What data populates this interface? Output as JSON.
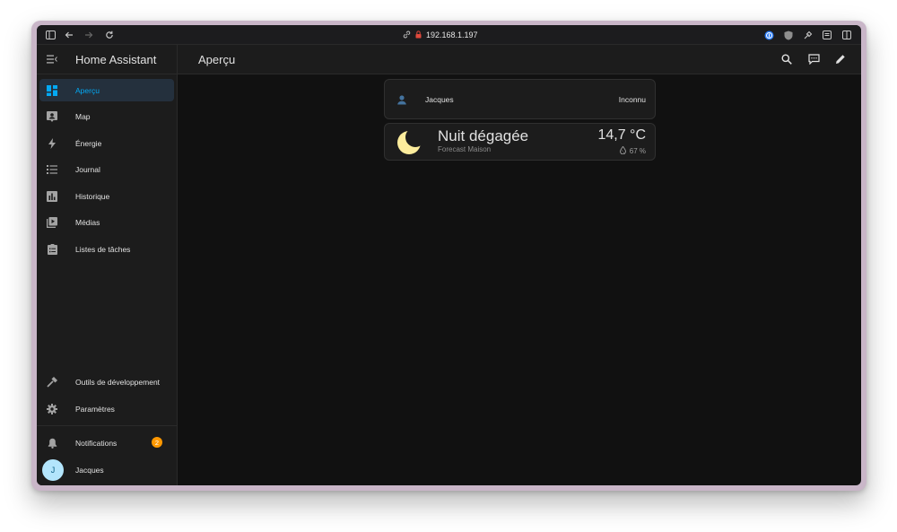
{
  "browser": {
    "url": "192.168.1.197"
  },
  "app": {
    "title": "Home Assistant",
    "page_title": "Aperçu"
  },
  "sidebar": {
    "items": [
      {
        "label": "Aperçu",
        "icon": "dashboard-icon",
        "active": true
      },
      {
        "label": "Map",
        "icon": "map-account-icon"
      },
      {
        "label": "Énergie",
        "icon": "lightning-bolt-icon"
      },
      {
        "label": "Journal",
        "icon": "list-icon"
      },
      {
        "label": "Historique",
        "icon": "chart-box-icon"
      },
      {
        "label": "Médias",
        "icon": "play-box-multiple-icon"
      },
      {
        "label": "Listes de tâches",
        "icon": "clipboard-list-icon"
      }
    ],
    "dev_tools": {
      "label": "Outils de développement",
      "icon": "hammer-icon"
    },
    "settings": {
      "label": "Paramètres",
      "icon": "cog-icon"
    },
    "notifications": {
      "label": "Notifications",
      "icon": "bell-icon",
      "count": "2"
    },
    "user": {
      "label": "Jacques",
      "initial": "J"
    }
  },
  "cards": {
    "person": {
      "name": "Jacques",
      "state": "Inconnu"
    },
    "weather": {
      "condition": "Nuit dégagée",
      "entity": "Forecast Maison",
      "temperature": "14,7 °C",
      "humidity": "67 %"
    }
  },
  "colors": {
    "accent": "#03a9f4",
    "badge": "#ff9800",
    "background": "#111111",
    "surface": "#1c1c1c"
  }
}
